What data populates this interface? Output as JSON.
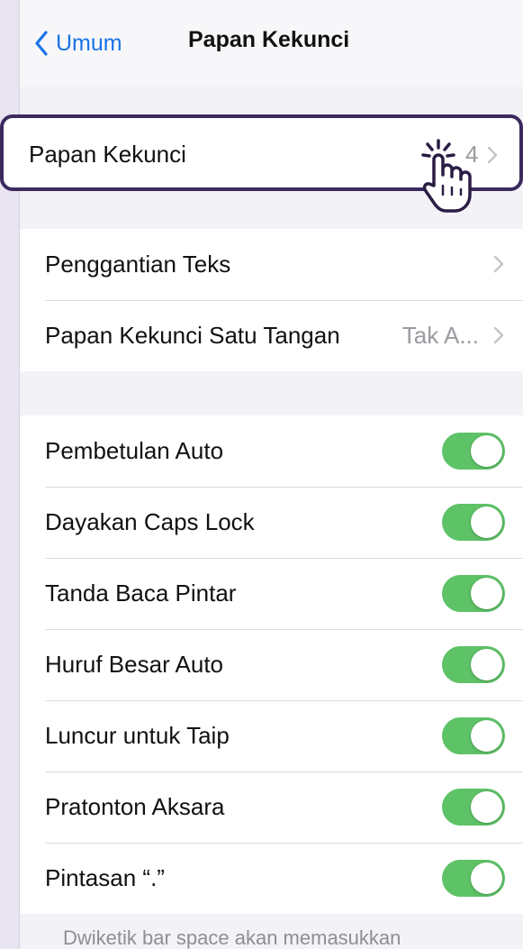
{
  "nav": {
    "back_label": "Umum",
    "title": "Papan Kekunci"
  },
  "keyboards_row": {
    "label": "Papan Kekunci",
    "count": "4"
  },
  "group2": [
    {
      "label": "Penggantian Teks",
      "detail": ""
    },
    {
      "label": "Papan Kekunci Satu Tangan",
      "detail": "Tak A..."
    }
  ],
  "toggles": [
    {
      "label": "Pembetulan Auto",
      "on": true
    },
    {
      "label": "Dayakan Caps Lock",
      "on": true
    },
    {
      "label": "Tanda Baca Pintar",
      "on": true
    },
    {
      "label": "Huruf Besar Auto",
      "on": true
    },
    {
      "label": "Luncur untuk Taip",
      "on": true
    },
    {
      "label": "Pratonton Aksara",
      "on": true
    },
    {
      "label": "Pintasan “.”",
      "on": true
    }
  ],
  "footer_text": "Dwiketik bar space akan memasukkan",
  "colors": {
    "accent": "#1a73e8",
    "toggle_on": "#5ec267",
    "highlight_border": "#3b2a5e",
    "background": "#f2f2f7"
  },
  "icons": [
    "chevron-left-icon",
    "chevron-right-icon",
    "pointer-hand-icon"
  ]
}
